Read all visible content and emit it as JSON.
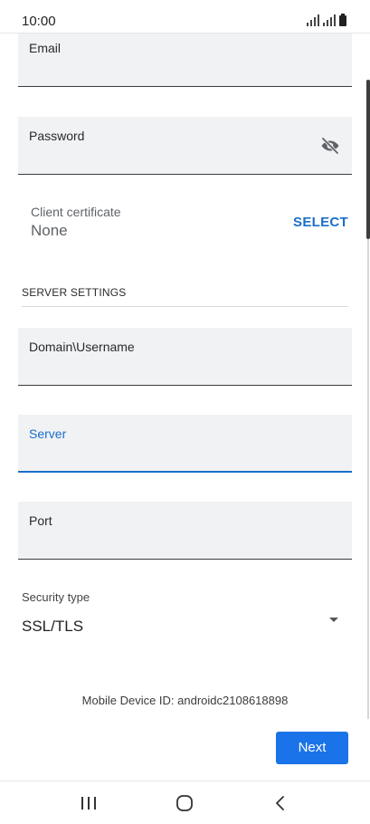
{
  "status_bar": {
    "time": "10:00",
    "signal_icon": "signal-icon",
    "battery_icon": "battery-icon"
  },
  "fields": {
    "email": {
      "label": "Email",
      "value": ""
    },
    "password": {
      "label": "Password",
      "value": "",
      "visibility_icon": "eye-off-icon"
    },
    "domain_username": {
      "label": "Domain\\Username",
      "value": ""
    },
    "server": {
      "label": "Server",
      "value": ""
    },
    "port": {
      "label": "Port",
      "value": ""
    }
  },
  "client_certificate": {
    "label": "Client certificate",
    "value": "None",
    "select_label": "SELECT"
  },
  "server_settings": {
    "header": "SERVER SETTINGS"
  },
  "security_type": {
    "label": "Security type",
    "value": "SSL/TLS"
  },
  "device_id": "Mobile Device ID: androidc2108618898",
  "next_label": "Next",
  "nav_bar": {
    "recents_icon": "recents-icon",
    "home_icon": "home-icon",
    "back_icon": "back-icon"
  },
  "colors": {
    "accent": "#1a73e8",
    "field_background": "#f1f2f4",
    "focused_underline": "#1a6fc9"
  }
}
